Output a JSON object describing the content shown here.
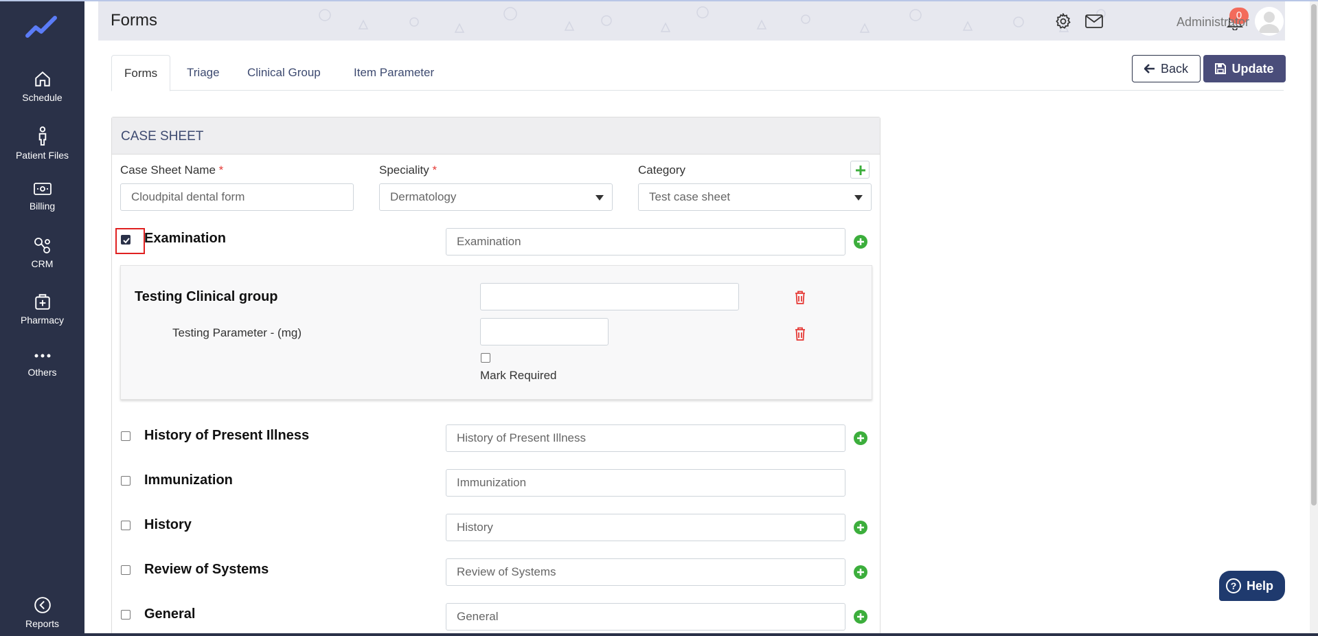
{
  "header": {
    "title": "Forms",
    "notification_count": "0",
    "user_name": "Administrator"
  },
  "sidebar": {
    "items": [
      {
        "label": "Schedule",
        "icon": "home-icon"
      },
      {
        "label": "Patient Files",
        "icon": "patient-icon"
      },
      {
        "label": "Billing",
        "icon": "billing-icon"
      },
      {
        "label": "CRM",
        "icon": "crm-icon"
      },
      {
        "label": "Pharmacy",
        "icon": "pharmacy-icon"
      },
      {
        "label": "Others",
        "icon": "more-icon"
      },
      {
        "label": "Reports",
        "icon": "reports-icon"
      }
    ]
  },
  "tabs": [
    {
      "label": "Forms",
      "active": true
    },
    {
      "label": "Triage",
      "active": false
    },
    {
      "label": "Clinical Group",
      "active": false
    },
    {
      "label": "Item Parameter",
      "active": false
    }
  ],
  "actions": {
    "back_label": "Back",
    "update_label": "Update"
  },
  "card": {
    "title": "CASE SHEET",
    "case_sheet_name_label": "Case Sheet Name",
    "case_sheet_name_value": "Cloudpital dental form",
    "speciality_label": "Speciality",
    "speciality_value": "Dermatology",
    "category_label": "Category",
    "category_value": "Test case sheet",
    "required_mark": "*"
  },
  "examination": {
    "label": "Examination",
    "input_value": "Examination",
    "checked": true,
    "group": {
      "title": "Testing Clinical group",
      "input_value": "",
      "parameter_label": "Testing Parameter - (mg)",
      "parameter_value": "",
      "mark_required_label": "Mark Required"
    }
  },
  "sections": [
    {
      "label": "History of Present Illness",
      "input_value": "History of Present Illness"
    },
    {
      "label": "Immunization",
      "input_value": "Immunization"
    },
    {
      "label": "History",
      "input_value": "History"
    },
    {
      "label": "Review of Systems",
      "input_value": "Review of Systems"
    },
    {
      "label": "General",
      "input_value": "General"
    }
  ],
  "help": {
    "label": "Help"
  },
  "colors": {
    "sidebar_bg": "#2a3148",
    "accent": "#4a4d7a",
    "plus_green": "#3cae3c",
    "trash_red": "#e53935",
    "badge": "#f36b5b"
  }
}
